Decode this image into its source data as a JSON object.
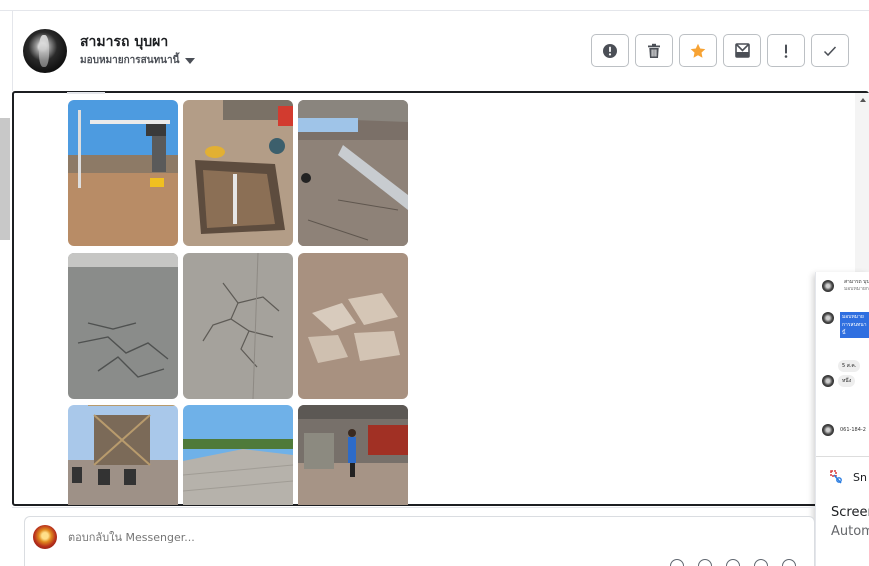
{
  "header": {
    "contact_name": "สามารถ บุบผา",
    "assign_label": "มอบหมายการสนทนานี้"
  },
  "toolbar": {
    "buttons": [
      {
        "icon": "alert-circle-icon"
      },
      {
        "icon": "trash-icon"
      },
      {
        "icon": "star-icon",
        "color": "#f7a334"
      },
      {
        "icon": "mark-unread-icon"
      },
      {
        "icon": "exclamation-icon"
      },
      {
        "icon": "check-icon"
      }
    ]
  },
  "thread": {
    "photos": 9
  },
  "floating_thumbnail": {
    "snip_label": "Sn",
    "screen_label": "Screer",
    "auto_label": "Autom",
    "mini_bubble_1": "5 ส.ค.",
    "mini_bubble_2": "หนึ่ง",
    "mini_phone": "061-184-2"
  },
  "composer": {
    "placeholder": "ตอบกลับใน Messenger..."
  }
}
